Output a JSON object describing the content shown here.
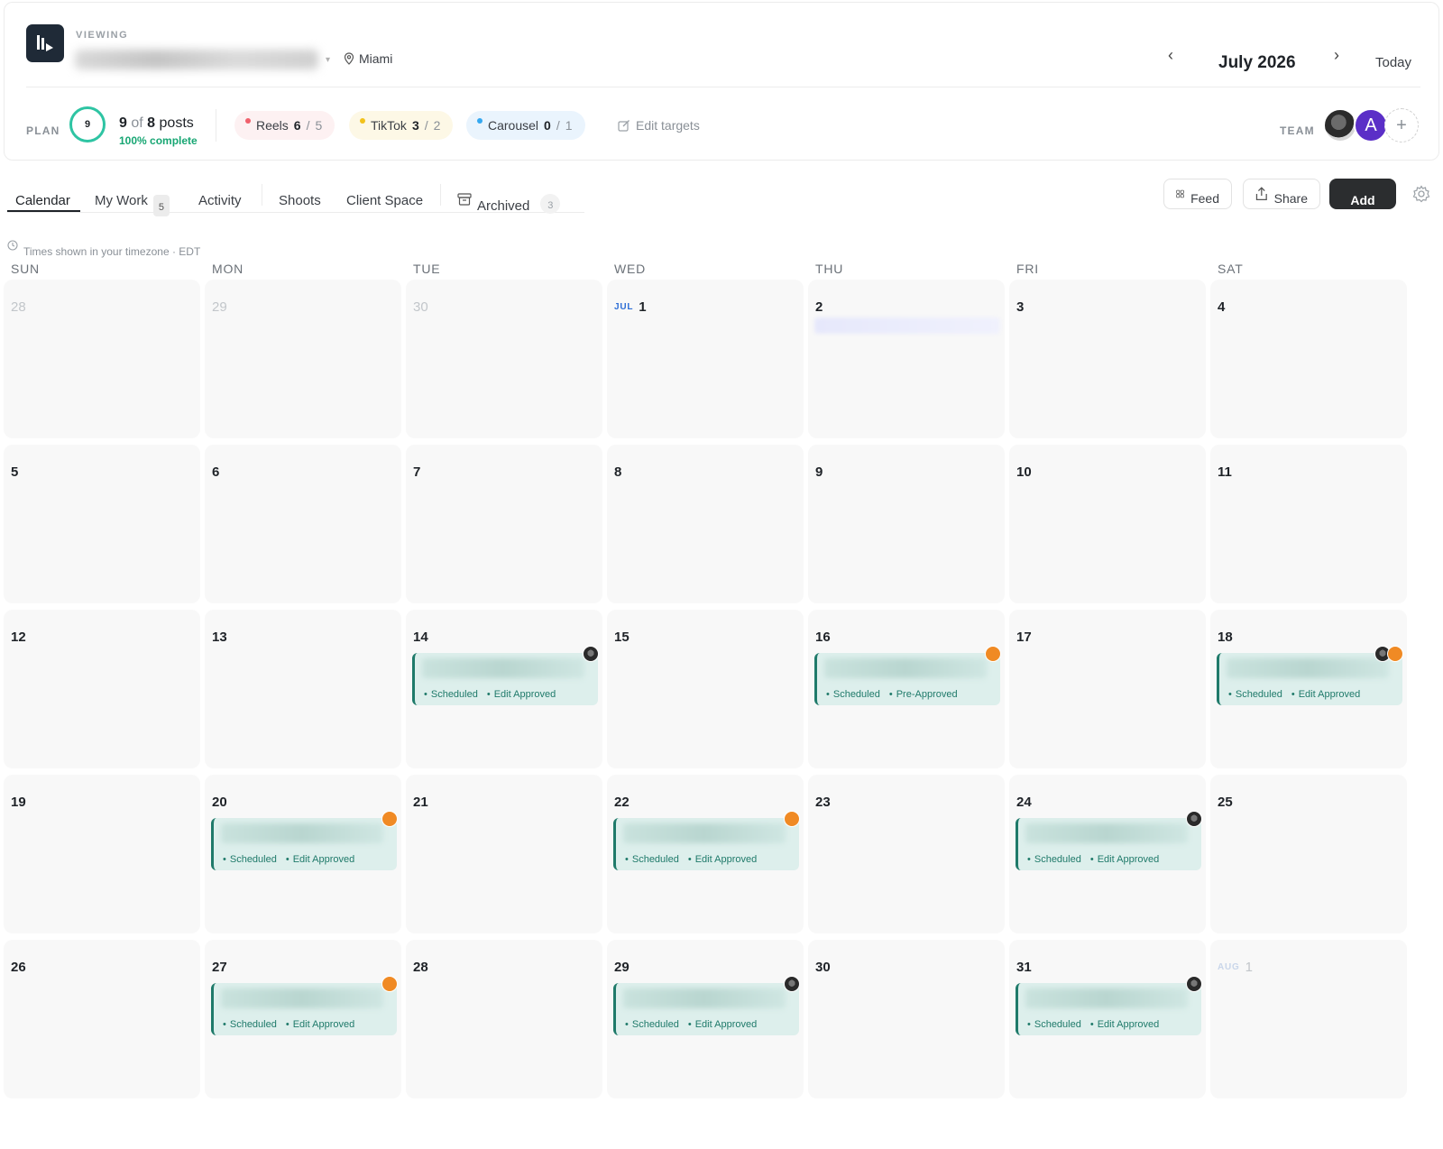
{
  "header": {
    "viewing_label": "VIEWING",
    "location": "Miami",
    "month_title": "July 2026",
    "today_label": "Today",
    "nav_prev_icon": "chevron-left-icon",
    "nav_next_icon": "chevron-right-icon"
  },
  "plan": {
    "label": "PLAN",
    "ring_value": "9",
    "posts_done": "9",
    "posts_of": "of",
    "posts_total": "8",
    "posts_word": "posts",
    "complete_text": "100% complete",
    "complete_fraction": 1.0
  },
  "targets": [
    {
      "name": "Reels",
      "done": "6",
      "target": "5",
      "color": "#f0606c"
    },
    {
      "name": "TikTok",
      "done": "3",
      "target": "2",
      "color": "#f2c21b"
    },
    {
      "name": "Carousel",
      "done": "0",
      "target": "1",
      "color": "#35a8f0"
    }
  ],
  "edit_targets_label": "Edit targets",
  "team": {
    "label": "TEAM",
    "avatar_letter": "A",
    "add_symbol": "+"
  },
  "tabs": {
    "calendar": "Calendar",
    "my_work": "My Work",
    "my_work_count": "5",
    "activity": "Activity",
    "shoots": "Shoots",
    "client_space": "Client Space",
    "archived": "Archived",
    "archived_count": "3"
  },
  "toolbar": {
    "feed": "Feed",
    "share": "Share",
    "add": "Add"
  },
  "timezone_note": "Times shown in your timezone · EDT",
  "days_of_week": [
    "SUN",
    "MON",
    "TUE",
    "WED",
    "THU",
    "FRI",
    "SAT"
  ],
  "month_tags": {
    "jul": "JUL",
    "aug": "AUG"
  },
  "weeks": [
    [
      "28",
      "29",
      "30",
      "1",
      "2",
      "3",
      "4"
    ],
    [
      "5",
      "6",
      "7",
      "8",
      "9",
      "10",
      "11"
    ],
    [
      "12",
      "13",
      "14",
      "15",
      "16",
      "17",
      "18"
    ],
    [
      "19",
      "20",
      "21",
      "22",
      "23",
      "24",
      "25"
    ],
    [
      "26",
      "27",
      "28",
      "29",
      "30",
      "31",
      "1"
    ]
  ],
  "posts": [
    {
      "status": "Scheduled",
      "approval": "Edit Approved"
    },
    {
      "status": "Scheduled",
      "approval": "Pre-Approved"
    },
    {
      "status": "Scheduled",
      "approval": "Edit Approved"
    },
    {
      "status": "Scheduled",
      "approval": "Edit Approved"
    },
    {
      "status": "Scheduled",
      "approval": "Edit Approved"
    },
    {
      "status": "Scheduled",
      "approval": "Edit Approved"
    },
    {
      "status": "Scheduled",
      "approval": "Edit Approved"
    },
    {
      "status": "Scheduled",
      "approval": "Edit Approved"
    },
    {
      "status": "Scheduled",
      "approval": "Edit Approved"
    }
  ],
  "colors": {
    "accent": "#1f7a6a",
    "ring": "#2ec4a3",
    "complete": "#17a673",
    "add_button": "#2b2d2f"
  }
}
